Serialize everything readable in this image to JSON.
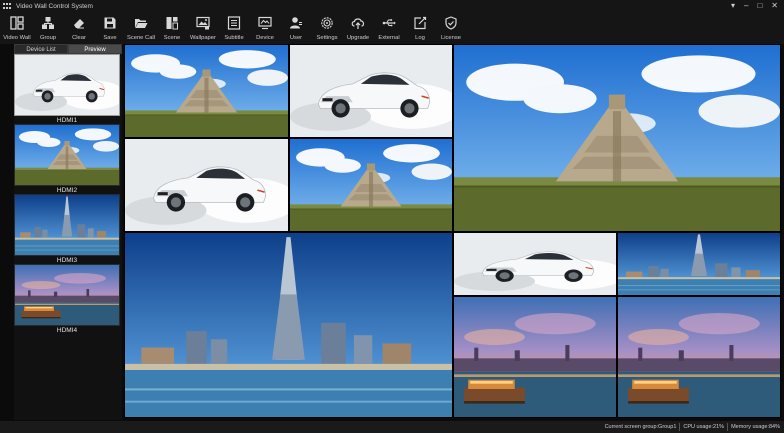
{
  "app": {
    "title": "Video Wall Control System"
  },
  "window_controls": [
    {
      "name": "pin-button",
      "glyph": "▾"
    },
    {
      "name": "minimize-button",
      "glyph": "–"
    },
    {
      "name": "restore-button",
      "glyph": "□"
    },
    {
      "name": "close-button",
      "glyph": "✕"
    }
  ],
  "toolbar": [
    {
      "id": "video-wall",
      "label": "Video Wall",
      "icon": "video-wall-icon"
    },
    {
      "id": "group",
      "label": "Group",
      "icon": "group-icon"
    },
    {
      "id": "clear",
      "label": "Clear",
      "icon": "eraser-icon"
    },
    {
      "id": "save",
      "label": "Save",
      "icon": "save-icon"
    },
    {
      "id": "scene-call",
      "label": "Scene Call",
      "icon": "folder-open-icon"
    },
    {
      "id": "scene",
      "label": "Scene",
      "icon": "scene-icon"
    },
    {
      "id": "wallpaper",
      "label": "Wallpaper",
      "icon": "wallpaper-icon"
    },
    {
      "id": "subtitle",
      "label": "Subtitle",
      "icon": "subtitle-icon"
    },
    {
      "id": "device",
      "label": "Device",
      "icon": "device-icon"
    },
    {
      "id": "user",
      "label": "User",
      "icon": "user-icon"
    },
    {
      "id": "settings",
      "label": "Settings",
      "icon": "settings-icon"
    },
    {
      "id": "upgrade",
      "label": "Upgrade",
      "icon": "cloud-upload-icon"
    },
    {
      "id": "external",
      "label": "External",
      "icon": "usb-icon"
    },
    {
      "id": "log",
      "label": "Log",
      "icon": "log-icon"
    },
    {
      "id": "license",
      "label": "License",
      "icon": "shield-check-icon"
    }
  ],
  "panel": {
    "tabs": [
      {
        "label": "Device List",
        "active": false
      },
      {
        "label": "Preview",
        "active": true
      }
    ],
    "sources": [
      {
        "name": "HDMI1",
        "scene": "car",
        "selected": true
      },
      {
        "name": "HDMI2",
        "scene": "pyramid",
        "selected": false
      },
      {
        "name": "HDMI3",
        "scene": "tower",
        "selected": false
      },
      {
        "name": "HDMI4",
        "scene": "sunset",
        "selected": false
      }
    ]
  },
  "wall": {
    "scenes": [
      "pyramid",
      "car",
      "car",
      "pyramid",
      "pyramid",
      "tower",
      "car",
      "tower",
      "sunset",
      "sunset"
    ]
  },
  "status": {
    "group": "Current screen group:Group1",
    "cpu": "CPU usage:21%",
    "memory": "Memory usage:84%"
  },
  "colors": {
    "background": "#0b0b0b",
    "toolbar": "#151515",
    "text": "#cfcfcf"
  }
}
